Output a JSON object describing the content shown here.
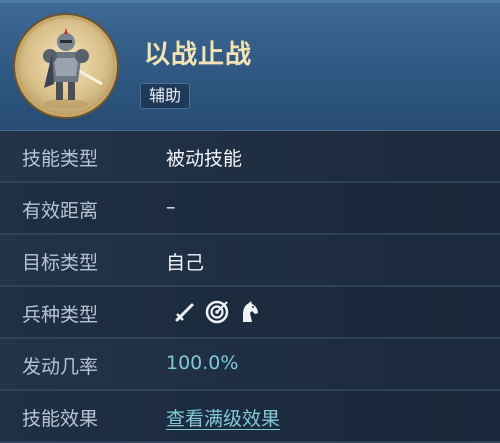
{
  "skill": {
    "name": "以战止战",
    "tag": "辅助",
    "portrait_icon": "armored-warrior-portrait"
  },
  "rows": [
    {
      "label": "技能类型",
      "value": "被动技能"
    },
    {
      "label": "有效距离",
      "value": "–"
    },
    {
      "label": "目标类型",
      "value": "自己"
    },
    {
      "label": "兵种类型",
      "icons": [
        "sword-icon",
        "target-icon",
        "horse-icon"
      ]
    },
    {
      "label": "发动几率",
      "value": "100.0%"
    },
    {
      "label": "技能效果",
      "value": "查看满级效果"
    }
  ],
  "colors": {
    "header_bg": "#2f5882",
    "title": "#f4e4b4",
    "accent_value": "#7fc9d9",
    "label": "#b6c3d2"
  }
}
